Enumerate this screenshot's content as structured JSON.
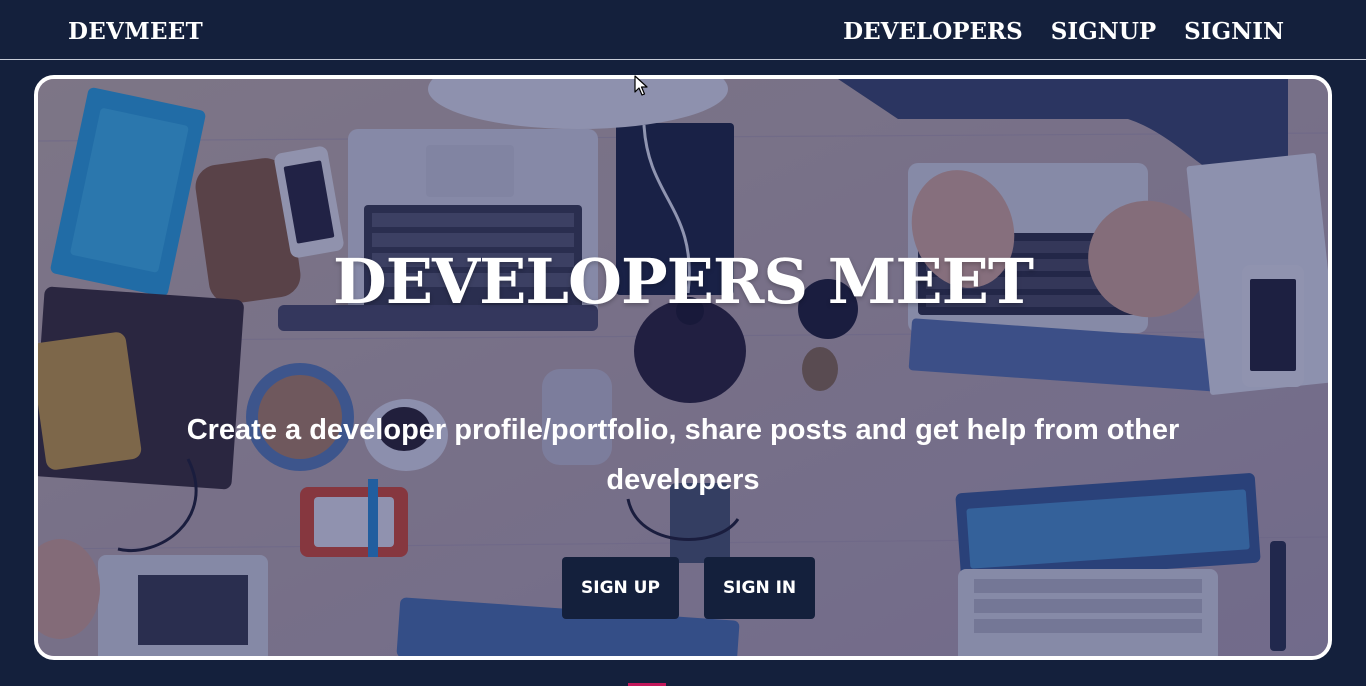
{
  "navbar": {
    "brand": "DEVMEET",
    "links": [
      {
        "label": "DEVELOPERS"
      },
      {
        "label": "SIGNUP"
      },
      {
        "label": "SIGNIN"
      }
    ]
  },
  "hero": {
    "title": "DEVELOPERS MEET",
    "subtitle": "Create a developer profile/portfolio, share posts and get help from other developers",
    "buttons": {
      "signup_label": "SIGN UP",
      "signin_label": "SIGN IN"
    }
  },
  "colors": {
    "navbar_bg": "#14203c",
    "button_bg": "#14203c",
    "overlay": "#16225a",
    "text": "#ffffff"
  },
  "icons": {
    "cursor": "mouse-pointer-icon"
  }
}
